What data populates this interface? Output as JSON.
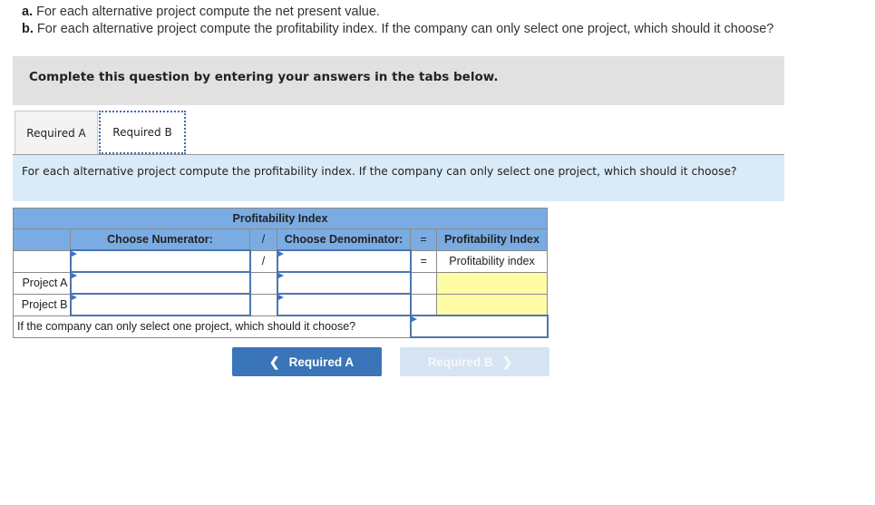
{
  "question": {
    "lines": [
      {
        "label": "a.",
        "text": " For each alternative project compute the net present value."
      },
      {
        "label": "b.",
        "text": " For each alternative project compute the profitability index. If the company can only select one project, which should it choose?"
      }
    ]
  },
  "banner": {
    "text": "Complete this question by entering your answers in the tabs below."
  },
  "tabs": [
    {
      "label": "Required A",
      "active": false
    },
    {
      "label": "Required B",
      "active": true
    }
  ],
  "instruction": "For each alternative project compute the profitability index. If the company can only select one project, which should it choose?",
  "table": {
    "title": "Profitability Index",
    "headers": {
      "numerator": "Choose Numerator:",
      "divide": "/",
      "denominator": "Choose Denominator:",
      "equals": "=",
      "result": "Profitability Index"
    },
    "formula_row": {
      "divide": "/",
      "equals": "=",
      "result": "Profitability index",
      "numerator_value": "",
      "denominator_value": ""
    },
    "rows": [
      {
        "label": "Project A",
        "numerator_value": "",
        "denominator_value": "",
        "result": ""
      },
      {
        "label": "Project B",
        "numerator_value": "",
        "denominator_value": "",
        "result": ""
      }
    ],
    "choice_question": "If the company can only select one project, which should it choose?",
    "choice_value": ""
  },
  "nav": {
    "prev_label": "Required A",
    "next_label": "Required B",
    "prev_icon": "chevron-left-icon",
    "next_icon": "chevron-right-icon"
  },
  "colors": {
    "header_blue": "#7aace3",
    "button_blue": "#3a74b9",
    "button_disabled": "#d6e3f2",
    "result_yellow": "#fefca5",
    "instruction_bg": "#d9eaf8"
  }
}
